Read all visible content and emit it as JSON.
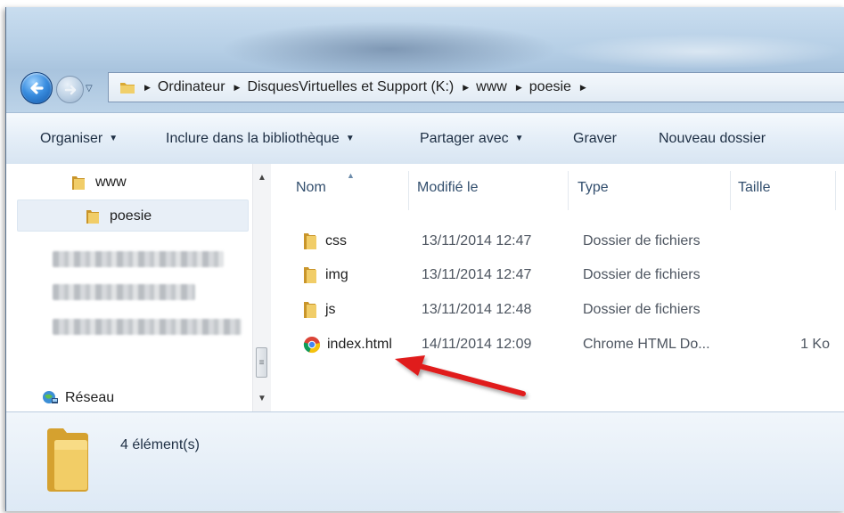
{
  "window": {
    "breadcrumb": [
      "Ordinateur",
      "DisquesVirtuelles et Support (K:)",
      "www",
      "poesie"
    ]
  },
  "toolbar": {
    "organize": "Organiser",
    "include_library": "Inclure dans la bibliothèque",
    "share_with": "Partager avec",
    "burn": "Graver",
    "new_folder": "Nouveau dossier"
  },
  "navpane": {
    "items": [
      {
        "label": "www",
        "icon": "folder-icon"
      },
      {
        "label": "poesie",
        "icon": "folder-icon",
        "selected": true
      }
    ],
    "network": {
      "label": "Réseau",
      "icon": "network-icon"
    }
  },
  "columns": {
    "name": "Nom",
    "modified": "Modifié le",
    "type": "Type",
    "size": "Taille"
  },
  "files": [
    {
      "name": "css",
      "modified": "13/11/2014 12:47",
      "type": "Dossier de fichiers",
      "size": "",
      "icon": "folder-icon"
    },
    {
      "name": "img",
      "modified": "13/11/2014 12:47",
      "type": "Dossier de fichiers",
      "size": "",
      "icon": "folder-icon"
    },
    {
      "name": "js",
      "modified": "13/11/2014 12:48",
      "type": "Dossier de fichiers",
      "size": "",
      "icon": "folder-icon"
    },
    {
      "name": "index.html",
      "modified": "14/11/2014 12:09",
      "type": "Chrome HTML Do...",
      "size": "1 Ko",
      "icon": "chrome-icon"
    }
  ],
  "status": {
    "count_label": "4 élément(s)"
  },
  "colors": {
    "annotation_arrow": "#e01b1b",
    "folder": "#e8c052",
    "selection": "#e8eff7"
  }
}
